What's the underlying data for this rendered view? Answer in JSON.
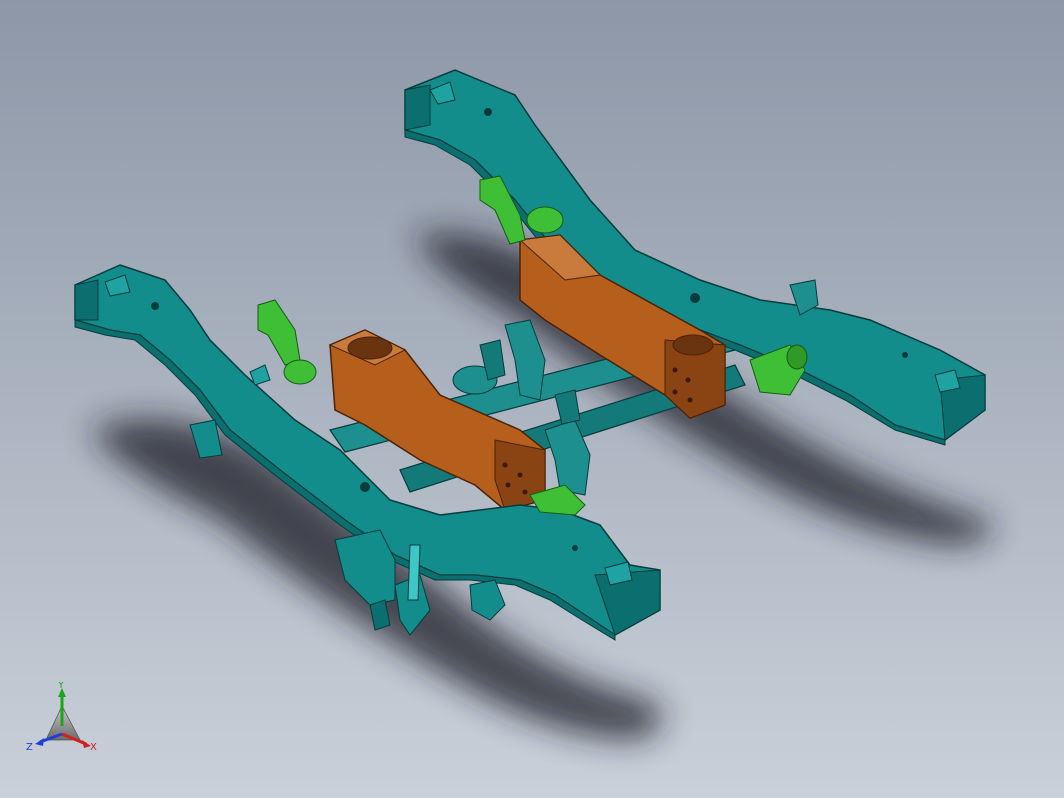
{
  "viewport": {
    "background_top": "#8d97a7",
    "background_bottom": "#c9d0d9"
  },
  "model": {
    "frame_color": "#138c8c",
    "frame_shade": "#0b6e6f",
    "frame_edge": "#063c3c",
    "bolster_color": "#b65f1d",
    "bolster_shade": "#8a4414",
    "bracket_color": "#3fbf36",
    "axle_color": "#1c8f8e"
  },
  "triad": {
    "x_label": "X",
    "y_label": "Y",
    "z_label": "Z",
    "x_color": "#d21f1f",
    "y_color": "#1aa61a",
    "z_color": "#1f3fd2"
  }
}
